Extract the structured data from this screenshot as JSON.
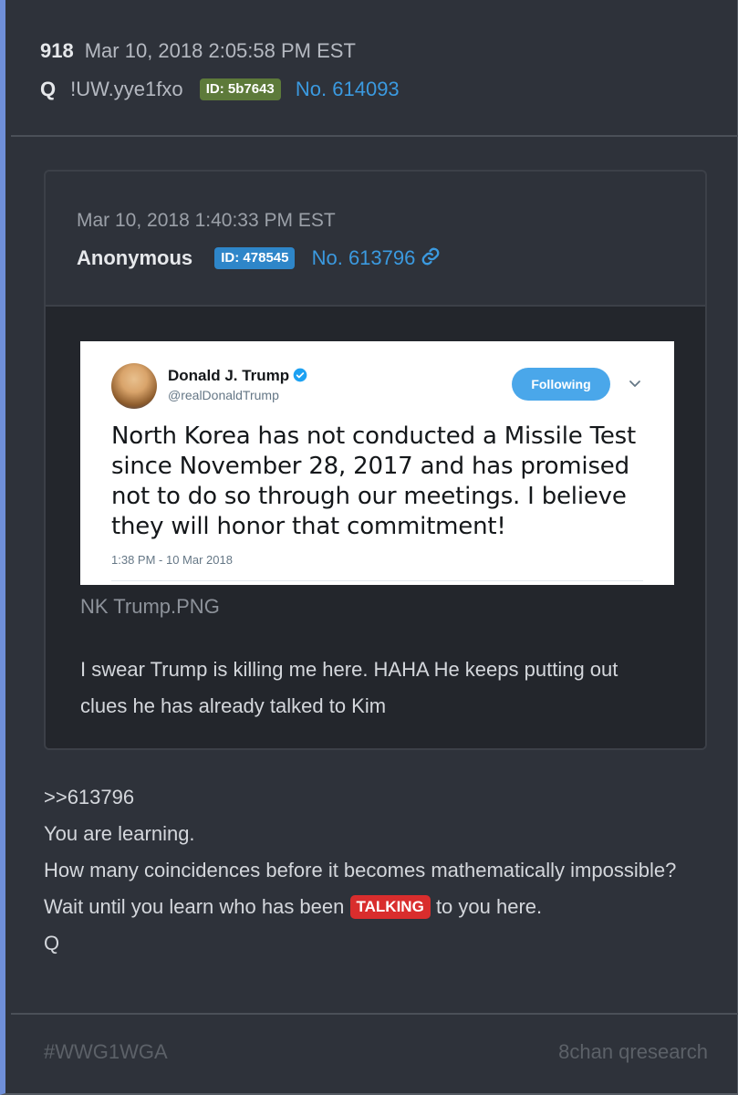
{
  "post": {
    "number": "918",
    "date": "Mar 10, 2018 2:05:58 PM EST",
    "name": "Q",
    "trip": "!UW.yye1fxo",
    "id_badge": "ID: 5b7643",
    "post_no": "No. 614093",
    "badge_color": "#5d7a3a"
  },
  "quoted": {
    "date": "Mar 10, 2018 1:40:33 PM EST",
    "name": "Anonymous",
    "id_badge": "ID: 478545",
    "post_no": "No. 613796",
    "link_icon": "link-icon",
    "image_filename": "NK Trump.PNG",
    "text": "I swear Trump is killing me here. HAHA He keeps putting out clues he has already talked to Kim",
    "tweet": {
      "author": "Donald J. Trump",
      "handle": "@realDonaldTrump",
      "follow_label": "Following",
      "text": "North Korea has not conducted a Missile Test since November 28, 2017 and has promised not to do so through our meetings. I believe they will honor that commitment!",
      "time": "1:38 PM - 10 Mar 2018"
    }
  },
  "body": {
    "reply_ref": ">>613796",
    "line1": "You are learning.",
    "line2": "How many coincidences before it becomes mathematically impossible?",
    "line3_pre": "Wait until you learn who has been",
    "line3_highlight": "TALKING",
    "line3_post": "to you here.",
    "signature": "Q"
  },
  "footer": {
    "hashtag": "#WWG1WGA",
    "source": "8chan qresearch"
  },
  "colors": {
    "accent_link": "#3b9ae0",
    "highlight_red": "#d92d2d",
    "left_border": "#6f8fd8"
  }
}
